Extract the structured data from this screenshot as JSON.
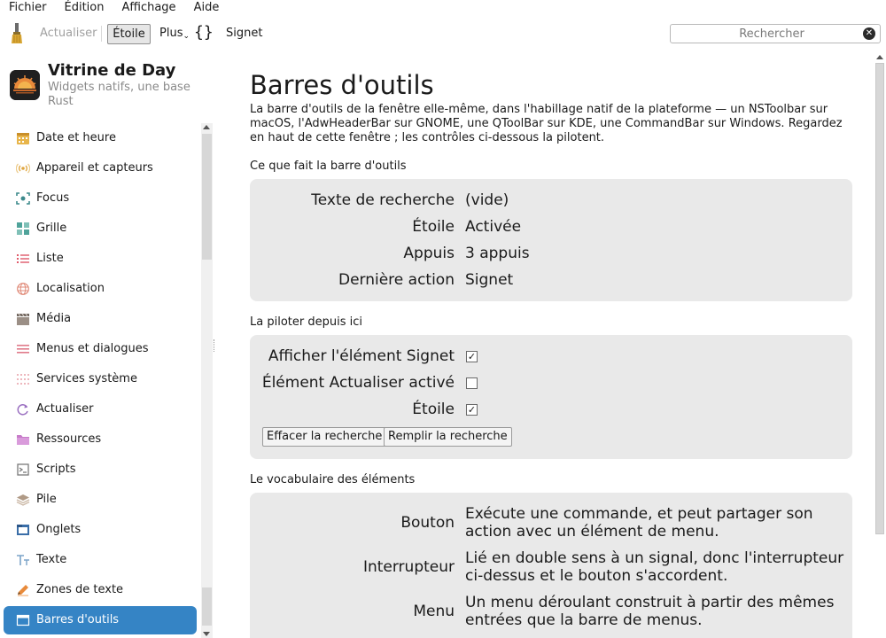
{
  "menubar": [
    "Fichier",
    "Édition",
    "Affichage",
    "Aide"
  ],
  "toolbar": {
    "refresh_label": "Actualiser",
    "star_label": "Étoile",
    "more_label": "Plus",
    "more_caret": "⌄",
    "braces": "{}",
    "bookmark_label": "Signet",
    "search_placeholder": "Rechercher",
    "search_value": "",
    "clear_glyph": "✕"
  },
  "sidebar": {
    "app_title": "Vitrine de Day",
    "app_subtitle": "Widgets natifs, une base Rust",
    "items": [
      {
        "label": "Date et heure",
        "icon": "calendar-icon"
      },
      {
        "label": "Appareil et capteurs",
        "icon": "sensor-icon"
      },
      {
        "label": "Focus",
        "icon": "focus-icon"
      },
      {
        "label": "Grille",
        "icon": "grid-icon"
      },
      {
        "label": "Liste",
        "icon": "list-icon"
      },
      {
        "label": "Localisation",
        "icon": "globe-icon"
      },
      {
        "label": "Média",
        "icon": "clapper-icon"
      },
      {
        "label": "Menus et dialogues",
        "icon": "menu-icon"
      },
      {
        "label": "Services système",
        "icon": "dots-grid-icon"
      },
      {
        "label": "Actualiser",
        "icon": "refresh-icon"
      },
      {
        "label": "Ressources",
        "icon": "folder-icon"
      },
      {
        "label": "Scripts",
        "icon": "scripts-icon"
      },
      {
        "label": "Pile",
        "icon": "stack-icon"
      },
      {
        "label": "Onglets",
        "icon": "tabs-icon"
      },
      {
        "label": "Texte",
        "icon": "text-icon"
      },
      {
        "label": "Zones de texte",
        "icon": "pencil-icon"
      },
      {
        "label": "Barres d'outils",
        "icon": "toolbar-icon"
      }
    ],
    "active_index": 16
  },
  "main": {
    "title": "Barres d'outils",
    "intro": "La barre d'outils de la fenêtre elle-même, dans l'habillage natif de la plateforme — un NSToolbar sur macOS, l'AdwHeaderBar sur GNOME, une QToolBar sur KDE, une CommandBar sur Windows. Regardez en haut de cette fenêtre ; les contrôles ci-dessous la pilotent.",
    "section1": {
      "title": "Ce que fait la barre d'outils",
      "rows": [
        {
          "key": "Texte de recherche",
          "value": "(vide)"
        },
        {
          "key": "Étoile",
          "value": "Activée"
        },
        {
          "key": "Appuis",
          "value": "3 appuis"
        },
        {
          "key": "Dernière action",
          "value": "Signet"
        }
      ]
    },
    "section2": {
      "title": "La piloter depuis ici",
      "checks": [
        {
          "label": "Afficher l'élément Signet",
          "checked": true
        },
        {
          "label": "Élément Actualiser activé",
          "checked": false
        },
        {
          "label": "Étoile",
          "checked": true
        }
      ],
      "check_glyph": "✓",
      "buttons": [
        "Effacer la recherche",
        "Remplir la recherche"
      ]
    },
    "section3": {
      "title": "Le vocabulaire des éléments",
      "rows": [
        {
          "key": "Bouton",
          "value": "Exécute une commande, et peut partager son action avec un élément de menu."
        },
        {
          "key": "Interrupteur",
          "value": "Lié en double sens à un signal, donc l'interrupteur ci-dessus et le bouton s'accordent."
        },
        {
          "key": "Menu",
          "value": "Un menu déroulant construit à partir des mêmes entrées que la barre de menus."
        }
      ]
    }
  },
  "colors": {
    "accent": "#3584c5",
    "card": "#e9e9e9",
    "disabled_text": "#a0a0a0"
  }
}
